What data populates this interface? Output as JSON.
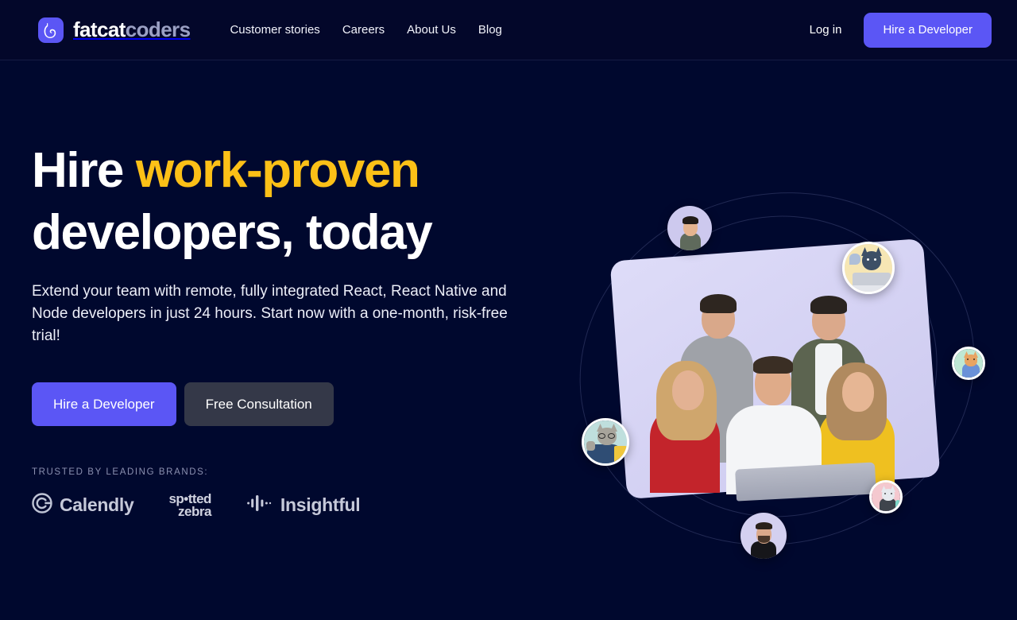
{
  "header": {
    "logo": {
      "name": "fatcatcoders",
      "bold_part": "fatcat",
      "light_part": "coders",
      "icon": "cat-icon",
      "mark_color": "#5b56f5"
    },
    "nav": [
      {
        "label": "Customer stories",
        "name": "nav-customer-stories"
      },
      {
        "label": "Careers",
        "name": "nav-careers"
      },
      {
        "label": "About Us",
        "name": "nav-about-us"
      },
      {
        "label": "Blog",
        "name": "nav-blog"
      }
    ],
    "login_label": "Log in",
    "cta_label": "Hire a Developer"
  },
  "hero": {
    "heading_part1": "Hire ",
    "heading_accent": "work-proven",
    "heading_part2": "developers, today",
    "accent_color": "#fcc017",
    "subheading": "Extend your team with remote, fully integrated React, React Native and Node developers in just 24 hours. Start now with a one-month, risk-free trial!",
    "primary_cta": "Hire a Developer",
    "secondary_cta": "Free Consultation",
    "trusted_label": "TRUSTED BY LEADING BRANDS:",
    "brands": [
      {
        "name": "Calendly",
        "icon": "calendly-logo-icon"
      },
      {
        "name": "spotted zebra",
        "line1": "sp•tted",
        "line2": "zebra",
        "icon": "spotted-zebra-logo-icon"
      },
      {
        "name": "Insightful",
        "icon": "insightful-logo-icon"
      }
    ]
  },
  "artwork": {
    "card_alt": "team-photo-card",
    "avatars": [
      {
        "name": "avatar-developer-top-left",
        "kind": "photo"
      },
      {
        "name": "avatar-cat-laptop-top-right",
        "kind": "illustration"
      },
      {
        "name": "avatar-cat-orange-right",
        "kind": "illustration"
      },
      {
        "name": "avatar-cat-pink-bottom-right",
        "kind": "illustration"
      },
      {
        "name": "avatar-developer-bottom",
        "kind": "photo"
      },
      {
        "name": "avatar-cat-glasses-left",
        "kind": "illustration"
      }
    ]
  },
  "colors": {
    "page_bg": "#00082e",
    "header_bg": "#03072a",
    "primary": "#5b56f5",
    "secondary_button": "#343848",
    "accent_yellow": "#fcc017",
    "card_lavender": "#dedcf8"
  }
}
